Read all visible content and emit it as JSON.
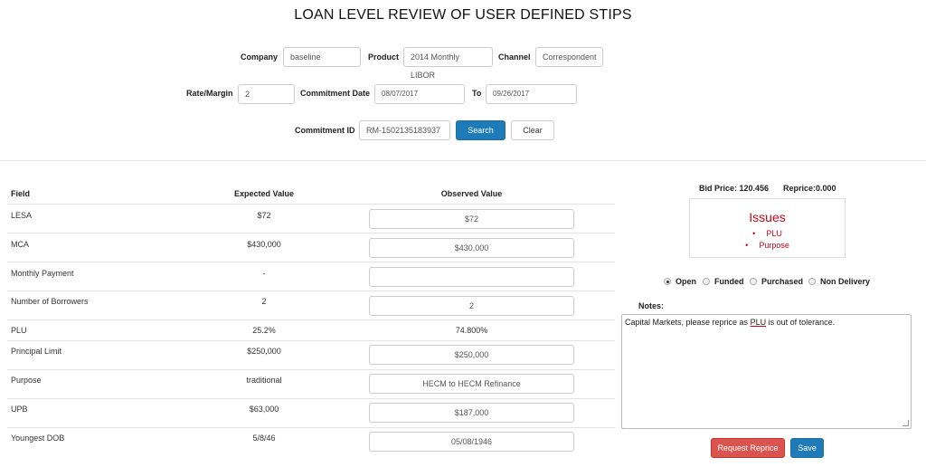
{
  "page": {
    "title": "LOAN LEVEL REVIEW OF USER DEFINED STIPS"
  },
  "filters": {
    "company_label": "Company",
    "company_value": "baseline",
    "product_label": "Product",
    "product_value": "2014 Monthly LIBOR",
    "channel_label": "Channel",
    "channel_value": "Correspondent",
    "rate_label": "Rate/Margin",
    "rate_value": "2",
    "commitment_date_label": "Commitment Date",
    "commitment_date_value": "08/07/2017",
    "to_label": "To",
    "to_value": "09/26/2017",
    "commitment_id_label": "Commitment ID",
    "commitment_id_value": "RM-1502135183937",
    "search_label": "Search",
    "clear_label": "Clear"
  },
  "table": {
    "headers": {
      "field": "Field",
      "expected": "Expected Value",
      "observed": "Observed Value"
    },
    "rows": [
      {
        "field": "LESA",
        "expected": "$72",
        "observed": "$72"
      },
      {
        "field": "MCA",
        "expected": "$430,000",
        "observed": "$430,000"
      },
      {
        "field": "Monthly Payment",
        "expected": "-",
        "observed": ""
      },
      {
        "field": "Number of Borrowers",
        "expected": "2",
        "observed": "2"
      },
      {
        "field": "PLU",
        "expected": "25.2%",
        "observed": "74.800%"
      },
      {
        "field": "Principal Limit",
        "expected": "$250,000",
        "observed": "$250,000"
      },
      {
        "field": "Purpose",
        "expected": "traditional",
        "observed": "HECM to HECM Refinance"
      },
      {
        "field": "UPB",
        "expected": "$63,000",
        "observed": "$187,000"
      },
      {
        "field": "Youngest DOB",
        "expected": "5/8/46",
        "observed": "05/08/1946"
      }
    ]
  },
  "summary": {
    "bid_price": "Bid Price: 120.456",
    "reprice": "Reprice:0.000",
    "issues_title": "Issues",
    "issues": [
      "PLU",
      "Purpose"
    ]
  },
  "status": {
    "options": [
      "Open",
      "Funded",
      "Purchased",
      "Non Delivery"
    ],
    "selected": "Open"
  },
  "notes": {
    "label": "Notes:",
    "text_before": "Capital Markets, please reprice as ",
    "text_underlined": "PLU",
    "text_after": " is out of tolerance."
  },
  "actions": {
    "request_reprice_label": "Request Reprice",
    "save_label": "Save"
  },
  "colors": {
    "primary": "#1e7bb8",
    "danger": "#d9534f",
    "issue_red": "#d0021b"
  }
}
